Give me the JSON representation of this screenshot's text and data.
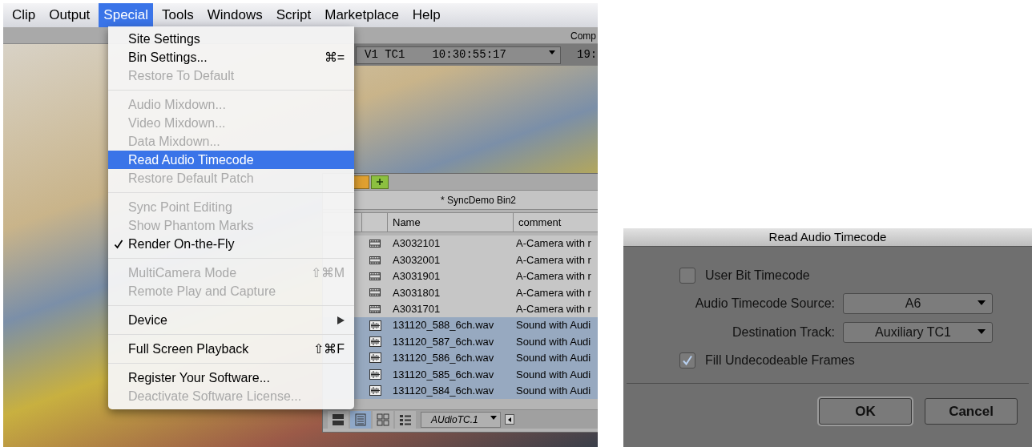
{
  "menu_bar": [
    {
      "label": "Clip",
      "selected": false
    },
    {
      "label": "Output",
      "selected": false
    },
    {
      "label": "Special",
      "selected": true
    },
    {
      "label": "Tools",
      "selected": false
    },
    {
      "label": "Windows",
      "selected": false
    },
    {
      "label": "Script",
      "selected": false
    },
    {
      "label": "Marketplace",
      "selected": false
    },
    {
      "label": "Help",
      "selected": false
    }
  ],
  "panel_title": "Comp",
  "timecode_bar": {
    "track": "V1 TC1",
    "timecode": "10:30:55:17",
    "second_timecode": "19:"
  },
  "special_menu": [
    [
      {
        "label": "Site Settings",
        "disabled": false,
        "selected": false,
        "checked": false
      },
      {
        "label": "Bin Settings...",
        "shortcut": "⌘=",
        "disabled": false,
        "selected": false,
        "checked": false
      },
      {
        "label": "Restore To Default",
        "disabled": true,
        "selected": false,
        "checked": false
      }
    ],
    [
      {
        "label": "Audio Mixdown...",
        "disabled": true,
        "selected": false,
        "checked": false
      },
      {
        "label": "Video Mixdown...",
        "disabled": true,
        "selected": false,
        "checked": false
      },
      {
        "label": "Data Mixdown...",
        "disabled": true,
        "selected": false,
        "checked": false
      },
      {
        "label": "Read Audio Timecode",
        "disabled": false,
        "selected": true,
        "checked": false
      },
      {
        "label": "Restore Default Patch",
        "disabled": true,
        "selected": false,
        "checked": false
      }
    ],
    [
      {
        "label": "Sync Point Editing",
        "disabled": true,
        "selected": false,
        "checked": false
      },
      {
        "label": "Show Phantom Marks",
        "disabled": true,
        "selected": false,
        "checked": false
      },
      {
        "label": "Render On-the-Fly",
        "disabled": false,
        "selected": false,
        "checked": true
      }
    ],
    [
      {
        "label": "MultiCamera Mode",
        "shortcut": "⇧⌘M",
        "disabled": true,
        "selected": false,
        "checked": false
      },
      {
        "label": "Remote Play and Capture",
        "disabled": true,
        "selected": false,
        "checked": false
      }
    ],
    [
      {
        "label": "Device",
        "submenu": true,
        "disabled": false,
        "selected": false,
        "checked": false
      }
    ],
    [
      {
        "label": "Full Screen Playback",
        "shortcut": "⇧⌘F",
        "disabled": false,
        "selected": false,
        "checked": false
      }
    ],
    [
      {
        "label": "Register Your Software...",
        "disabled": false,
        "selected": false,
        "checked": false
      },
      {
        "label": "Deactivate Software License...",
        "disabled": true,
        "selected": false,
        "checked": false
      }
    ]
  ],
  "bin": {
    "title": "* SyncDemo Bin2",
    "columns": [
      "Name",
      "comment"
    ],
    "rows": [
      {
        "kind": "clip",
        "name": "A3032101",
        "comment": "A-Camera with r",
        "selected": false
      },
      {
        "kind": "clip",
        "name": "A3032001",
        "comment": "A-Camera with r",
        "selected": false
      },
      {
        "kind": "clip",
        "name": "A3031901",
        "comment": "A-Camera with r",
        "selected": false
      },
      {
        "kind": "clip",
        "name": "A3031801",
        "comment": "A-Camera with r",
        "selected": false
      },
      {
        "kind": "clip",
        "name": "A3031701",
        "comment": "A-Camera with r",
        "selected": false
      },
      {
        "kind": "audio",
        "name": "131120_588_6ch.wav",
        "comment": "Sound with Audi",
        "selected": true
      },
      {
        "kind": "audio",
        "name": "131120_587_6ch.wav",
        "comment": "Sound with Audi",
        "selected": true
      },
      {
        "kind": "audio",
        "name": "131120_586_6ch.wav",
        "comment": "Sound with Audi",
        "selected": true
      },
      {
        "kind": "audio",
        "name": "131120_585_6ch.wav",
        "comment": "Sound with Audi",
        "selected": true
      },
      {
        "kind": "audio",
        "name": "131120_584_6ch.wav",
        "comment": "Sound with Audi",
        "selected": true
      }
    ],
    "view_modes": [
      {
        "kind": "frame",
        "selected": false
      },
      {
        "kind": "text",
        "selected": true
      },
      {
        "kind": "script",
        "selected": false
      },
      {
        "kind": "list",
        "selected": false
      }
    ],
    "bin_view": "AUdioTC.1"
  },
  "dialog": {
    "title": "Read Audio Timecode",
    "user_bit": {
      "label": "User Bit Timecode",
      "checked": false
    },
    "fields": [
      {
        "label": "Audio Timecode Source:",
        "value": "A6"
      },
      {
        "label": "Destination Track:",
        "value": "Auxiliary TC1"
      }
    ],
    "fill_frames": {
      "label": "Fill Undecodeable Frames",
      "checked": true
    },
    "buttons": [
      {
        "label": "OK",
        "default": true
      },
      {
        "label": "Cancel",
        "default": false
      }
    ]
  }
}
